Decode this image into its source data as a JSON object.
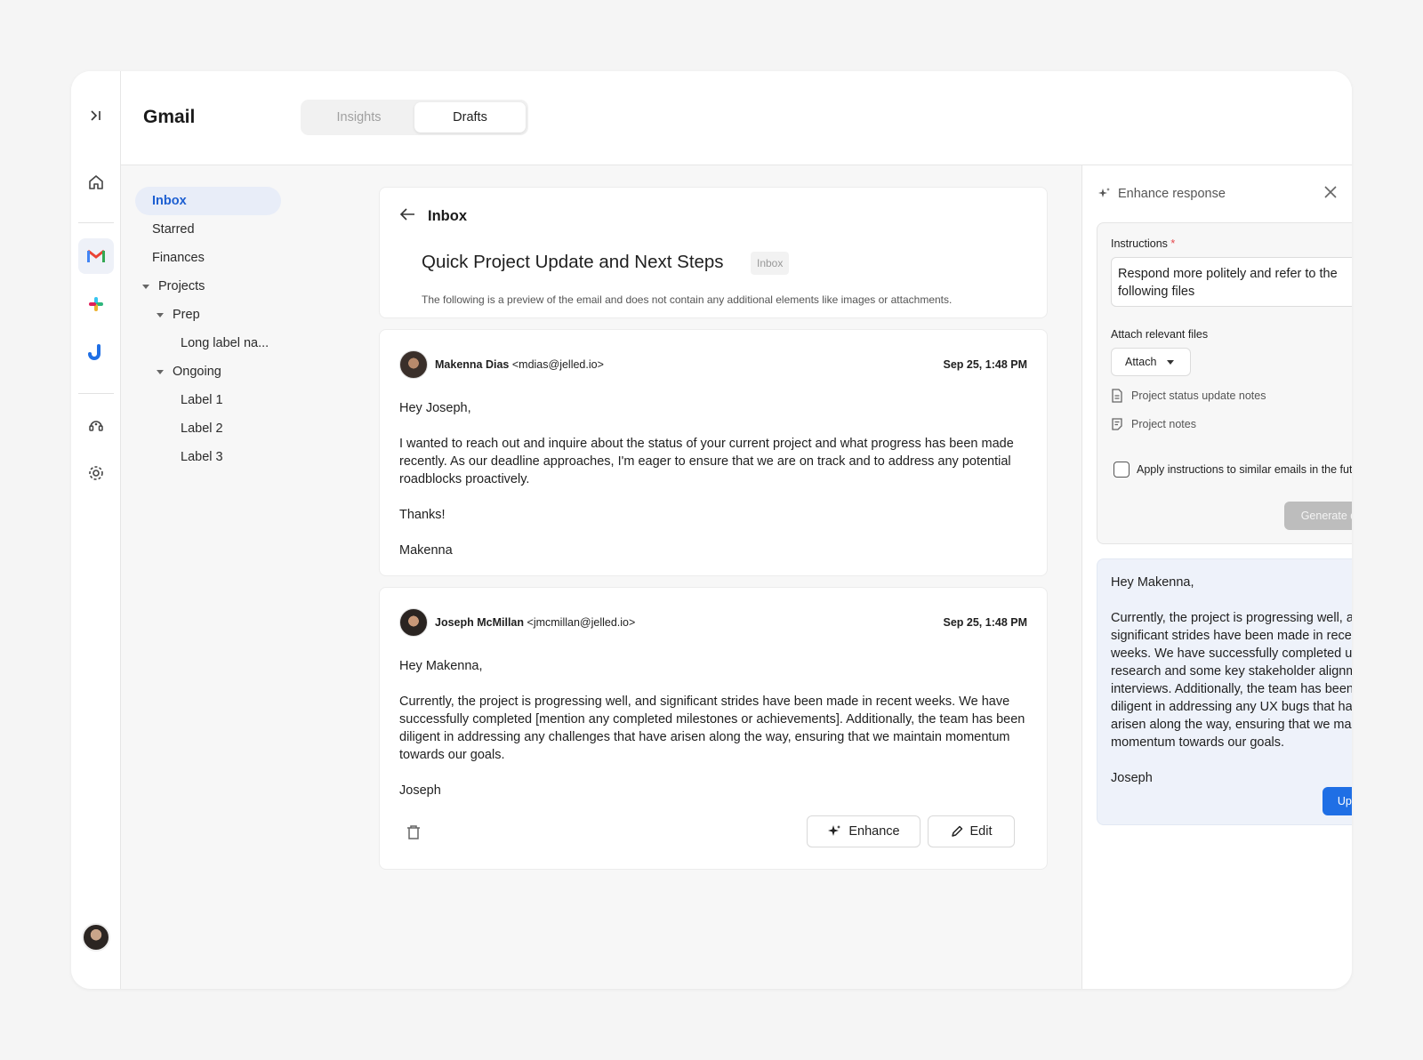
{
  "app": {
    "title": "Gmail",
    "tabs": [
      {
        "label": "Insights",
        "active": false
      },
      {
        "label": "Drafts",
        "active": true
      }
    ]
  },
  "rail": {
    "icons": [
      "sidebar-expand-icon",
      "home-icon",
      "gmail-icon",
      "slack-icon",
      "jira-icon",
      "support-icon",
      "gear-icon"
    ]
  },
  "nav": {
    "items": [
      {
        "label": "Inbox"
      },
      {
        "label": "Starred"
      },
      {
        "label": "Finances"
      },
      {
        "label": "Projects"
      },
      {
        "label": "Prep"
      },
      {
        "label": "Long label na..."
      },
      {
        "label": "Ongoing"
      },
      {
        "label": "Label 1"
      },
      {
        "label": "Label 2"
      },
      {
        "label": "Label 3"
      }
    ]
  },
  "email": {
    "back_label": "Inbox",
    "subject": "Quick Project Update and Next Steps",
    "tag": "Inbox",
    "preview_note": "The following is a preview of the email and does not contain any additional elements like images or attachments.",
    "messages": [
      {
        "sender_name": "Makenna Dias",
        "sender_email": "<mdias@jelled.io>",
        "date": "Sep 25, 1:48 PM",
        "body": [
          "Hey Joseph,",
          "I wanted to reach out and inquire about the status of your current project and what progress has been made recently. As our deadline approaches, I'm eager to ensure that we are on track and to address any potential roadblocks proactively.",
          "Thanks!",
          "Makenna"
        ]
      },
      {
        "sender_name": "Joseph McMillan",
        "sender_email": "<jmcmillan@jelled.io>",
        "date": "Sep 25, 1:48 PM",
        "body": [
          "Hey Makenna,",
          "Currently, the project is progressing well, and significant strides have been made in recent weeks. We have successfully completed [mention any completed milestones or achievements]. Additionally, the team has been diligent in addressing any challenges that have arisen along the way, ensuring that we maintain momentum towards our goals.",
          "Joseph"
        ]
      }
    ],
    "actions": {
      "enhance": "Enhance",
      "edit": "Edit"
    }
  },
  "panel": {
    "title": "Enhance response",
    "instructions_label": "Instructions",
    "required_mark": "*",
    "instructions_value": "Respond more politely and refer to the following files",
    "attach_label": "Attach relevant files",
    "attach_button": "Attach",
    "files": [
      "Project status update notes",
      "Project notes"
    ],
    "checkbox_label": "Apply instructions to similar emails in the future",
    "generate_button": "Generate draft",
    "draft": [
      "Hey Makenna,",
      "Currently, the project is progressing well, and significant strides have been made in recent weeks. We have successfully completed user research and some key stakeholder alignment interviews. Additionally, the team has been diligent in addressing any UX bugs that have arisen along the way, ensuring that we maintain momentum towards our goals.",
      "Joseph"
    ],
    "update_button": "Update"
  },
  "colors": {
    "accent": "#1f6fe5",
    "nav_active_bg": "#e8edf8",
    "nav_active_text": "#1d5fd1",
    "draft_bg": "#eef2fa",
    "required": "#e5484d"
  }
}
